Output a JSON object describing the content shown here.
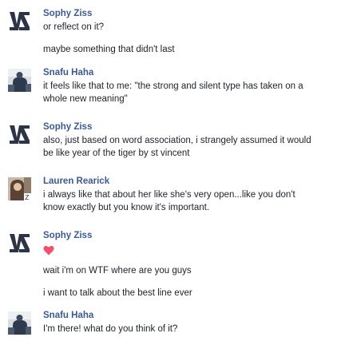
{
  "messages": [
    {
      "sender": "Sophy Ziss",
      "avatar": "sophy-avatar-icon",
      "lines": [
        "or reflect on it?",
        "maybe something that didn't last"
      ]
    },
    {
      "sender": "Snafu Haha",
      "avatar": "snafu-avatar-icon",
      "lines": [
        "it feels like that to me: \"the strong and silent type has taken on a",
        "whole new meaning\""
      ]
    },
    {
      "sender": "Sophy Ziss",
      "avatar": "sophy-avatar-icon",
      "lines": [
        "also, just based on word association, i strangely assumed it would",
        "be like year of the tiger by st vincent"
      ]
    },
    {
      "sender": "Lauren Rearick",
      "avatar": "lauren-avatar-icon",
      "lines": [
        "i always like that about her like she's very open...like you don't",
        "know exactly but you know it's important."
      ]
    },
    {
      "sender": "Sophy Ziss",
      "avatar": "sophy-avatar-icon",
      "emoji": "heart-icon",
      "lines": [
        "wait i'm on WTF where are you guys",
        "i want to talk about the best line ever"
      ]
    },
    {
      "sender": "Snafu Haha",
      "avatar": "snafu-avatar-icon",
      "lines": [
        "I'm there! what do you think of it?"
      ]
    }
  ],
  "colors": {
    "sender_name": "#3b5998",
    "message_text": "#1d2129",
    "heart": "#f25268"
  }
}
